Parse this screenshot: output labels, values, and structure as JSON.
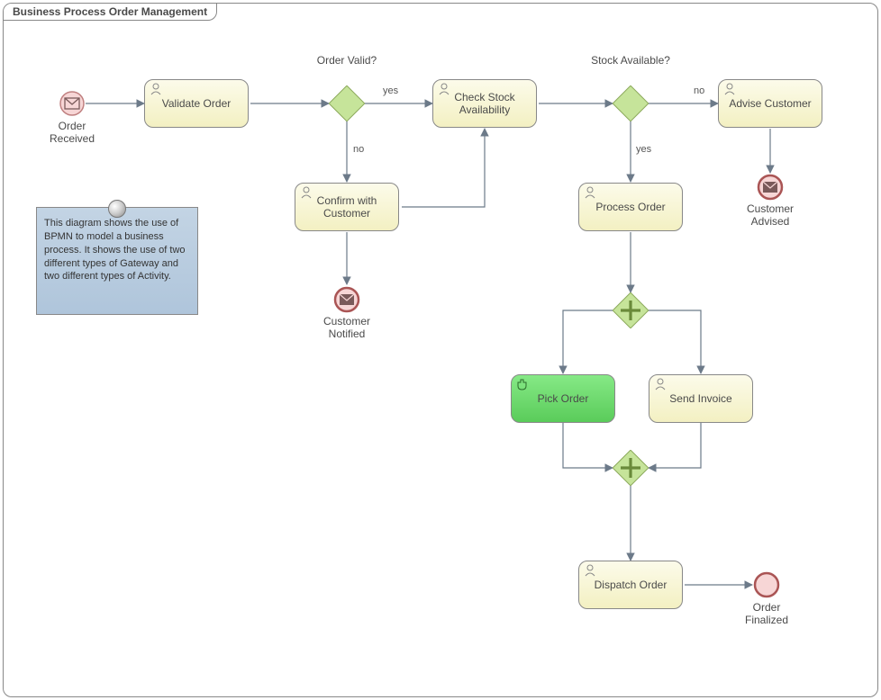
{
  "pool": {
    "title": "Business Process Order Management"
  },
  "tasks": {
    "validate": "Validate Order",
    "checkStock": "Check Stock Availability",
    "advise": "Advise Customer",
    "confirm": "Confirm with Customer",
    "process": "Process Order",
    "pick": "Pick Order",
    "invoice": "Send Invoice",
    "dispatch": "Dispatch Order"
  },
  "gateways": {
    "g1": "Order Valid?",
    "g2": "Stock Available?"
  },
  "edgeLabels": {
    "g1yes": "yes",
    "g1no": "no",
    "g2yes": "yes",
    "g2no": "no"
  },
  "events": {
    "start": "Order Received",
    "notified": "Customer Notified",
    "advised": "Customer Advised",
    "finalized": "Order Finalized"
  },
  "note": "This diagram shows the use of BPMN to model a business process. It shows the use of two different types of Gateway and two different types of Activity."
}
